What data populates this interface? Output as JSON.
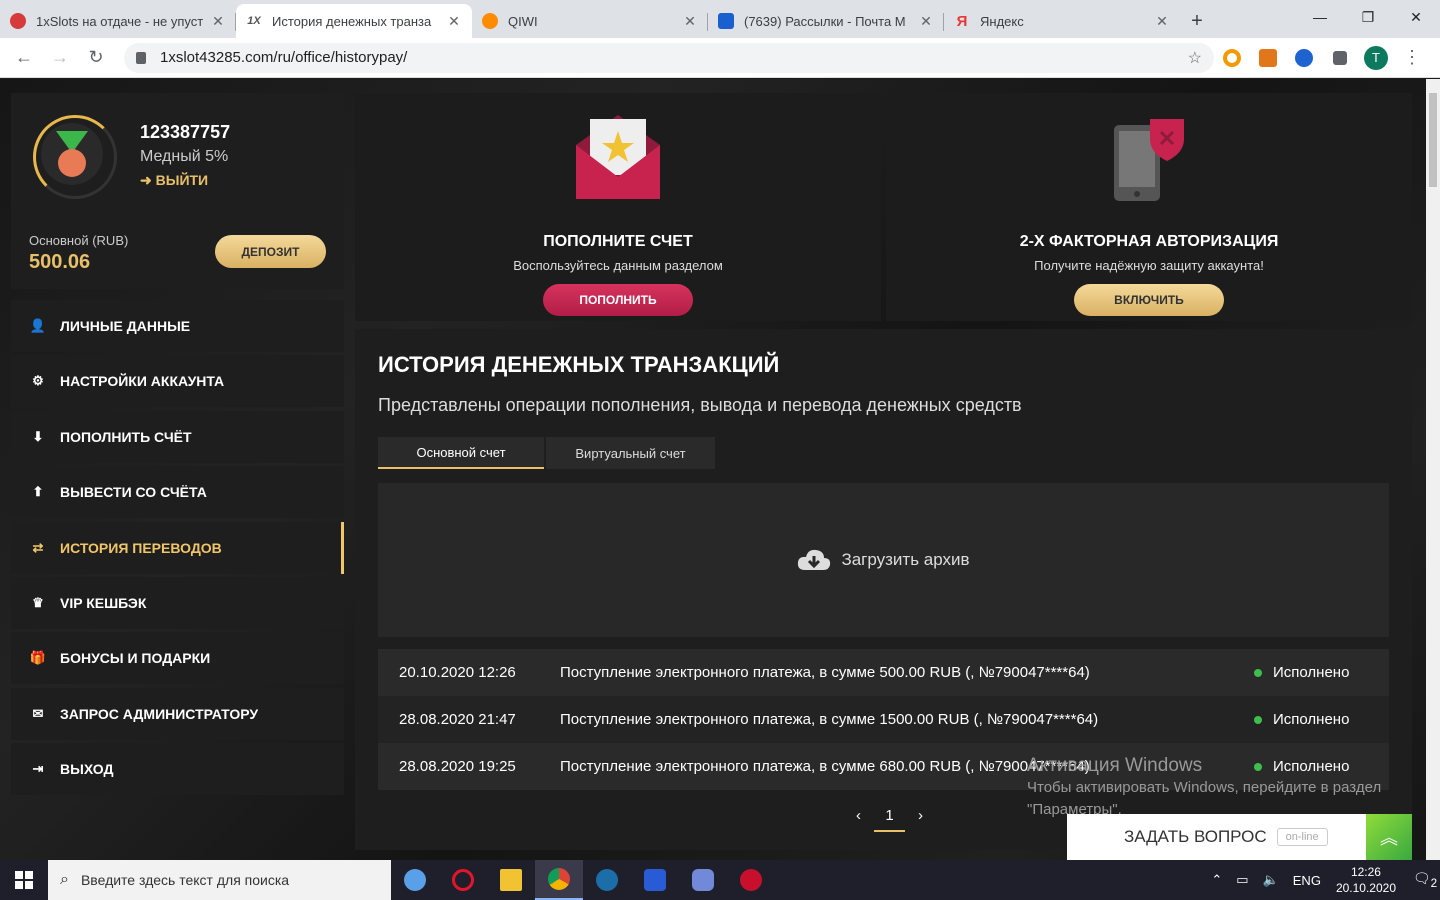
{
  "browser": {
    "tabs": [
      {
        "title": "1xSlots на отдаче - не упуст",
        "icon": "casino-chip-icon",
        "color": "#d63a3a"
      },
      {
        "title": "История денежных транза",
        "icon": "1x-logo-icon",
        "color": "#555555",
        "active": true
      },
      {
        "title": "QIWI",
        "icon": "qiwi-icon",
        "color": "#ff8c00"
      },
      {
        "title": "(7639) Рассылки - Почта М",
        "icon": "mail-icon",
        "color": "#1a5fd0"
      },
      {
        "title": "Яндекс",
        "icon": "yandex-icon",
        "color": "#e53935"
      }
    ],
    "url": "1xslot43285.com/ru/office/historypay/",
    "profile_initial": "T"
  },
  "account": {
    "id": "123387757",
    "level": "Медный 5%",
    "logout": "ВЫЙТИ",
    "balance_label": "Основной (RUB)",
    "balance": "500.06",
    "deposit": "ДЕПОЗИТ"
  },
  "menu": [
    {
      "label": "ЛИЧНЫЕ ДАННЫЕ",
      "icon": "user-add-icon"
    },
    {
      "label": "НАСТРОЙКИ АККАУНТА",
      "icon": "gears-icon"
    },
    {
      "label": "ПОПОЛНИТЬ СЧЁТ",
      "icon": "download-icon"
    },
    {
      "label": "ВЫВЕСТИ СО СЧЁТА",
      "icon": "upload-icon"
    },
    {
      "label": "ИСТОРИЯ ПЕРЕВОДОВ",
      "icon": "transfer-arrows-icon",
      "active": true
    },
    {
      "label": "VIP КЕШБЭК",
      "icon": "crown-icon"
    },
    {
      "label": "БОНУСЫ И ПОДАРКИ",
      "icon": "gift-icon"
    },
    {
      "label": "ЗАПРОС АДМИНИСТРАТОРУ",
      "icon": "envelope-icon"
    },
    {
      "label": "ВЫХОД",
      "icon": "exit-icon"
    }
  ],
  "promo1": {
    "title": "ПОПОЛНИТЕ СЧЕТ",
    "text": "Воспользуйтесь данным разделом",
    "button": "ПОПОЛНИТЬ"
  },
  "promo2": {
    "title": "2-Х ФАКТОРНАЯ АВТОРИЗАЦИЯ",
    "text": "Получите надёжную защиту аккаунта!",
    "button": "ВКЛЮЧИТЬ"
  },
  "history": {
    "title": "ИСТОРИЯ ДЕНЕЖНЫХ ТРАНЗАКЦИЙ",
    "subtitle": "Представлены операции пополнения, вывода и перевода денежных средств",
    "tabs": [
      "Основной счет",
      "Виртуальный счет"
    ],
    "archive": "Загрузить архив",
    "rows": [
      {
        "date": "20.10.2020 12:26",
        "desc": "Поступление электронного платежа, в сумме 500.00 RUB (, №790047****64)",
        "status": "Исполнено"
      },
      {
        "date": "28.08.2020 21:47",
        "desc": "Поступление электронного платежа, в сумме 1500.00 RUB (, №790047****64)",
        "status": "Исполнено"
      },
      {
        "date": "28.08.2020 19:25",
        "desc": "Поступление электронного платежа, в сумме 680.00 RUB (, №790047****64)",
        "status": "Исполнено"
      }
    ],
    "page": "1",
    "prev": "‹",
    "next": "›"
  },
  "watermark": {
    "line1": "Активация Windows",
    "line2": "Чтобы активировать Windows, перейдите в раздел",
    "line3": "\"Параметры\"."
  },
  "support": {
    "label": "ЗАДАТЬ ВОПРОС",
    "status": "on-line"
  },
  "taskbar": {
    "search_placeholder": "Введите здесь текст для поиска",
    "lang": "ENG",
    "time": "12:26",
    "date": "20.10.2020",
    "notifications": "2"
  }
}
